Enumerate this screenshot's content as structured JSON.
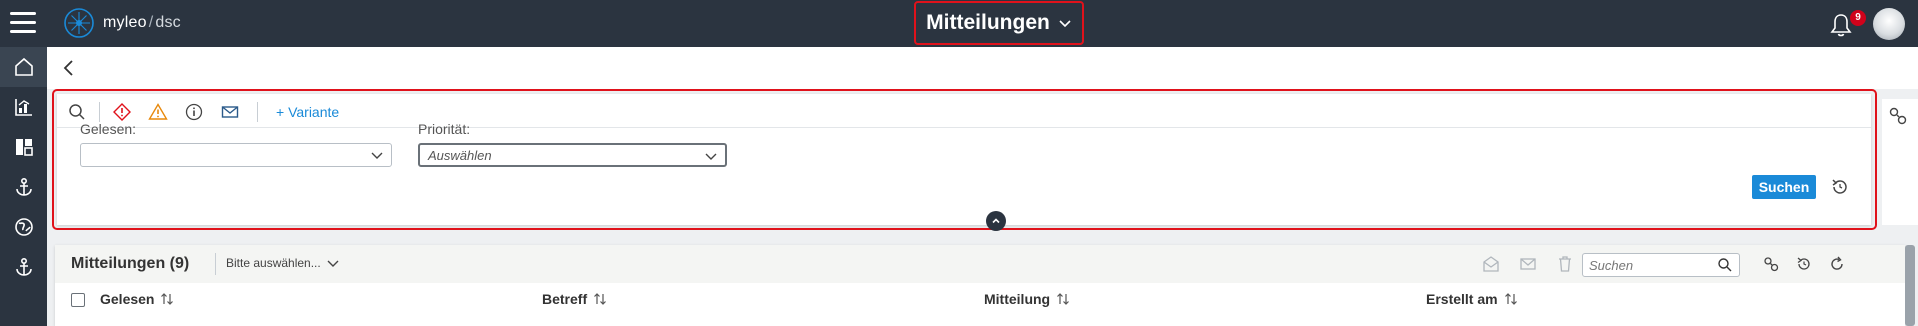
{
  "app": {
    "logo_name": "myleo",
    "logo_separator": "/",
    "logo_suffix": "dsc",
    "page_title": "Mitteilungen",
    "notification_count": "9"
  },
  "sidebar": {
    "items": [
      {
        "icon": "home-icon"
      },
      {
        "icon": "chart-icon"
      },
      {
        "icon": "dashboard-icon"
      },
      {
        "icon": "anchor-icon"
      },
      {
        "icon": "globe-icon"
      },
      {
        "icon": "anchor-icon"
      }
    ]
  },
  "filter": {
    "variant_button": "+ Variante",
    "fields": {
      "read_label": "Gelesen:",
      "read_value": "",
      "priority_label": "Priorität:",
      "priority_value": "Auswählen"
    },
    "search_button": "Suchen",
    "tools": [
      "search-icon",
      "error-icon",
      "warning-icon",
      "info-icon",
      "mail-icon"
    ],
    "colors": {
      "error": "#e0121b",
      "warning": "#e8890c",
      "accent": "#1a8ad8"
    }
  },
  "list": {
    "title": "Mitteilungen (9)",
    "variant_select": "Bitte auswählen...",
    "search_placeholder": "Suchen",
    "columns": [
      "Gelesen",
      "Betreff",
      "Mitteilung",
      "Erstellt am"
    ]
  }
}
